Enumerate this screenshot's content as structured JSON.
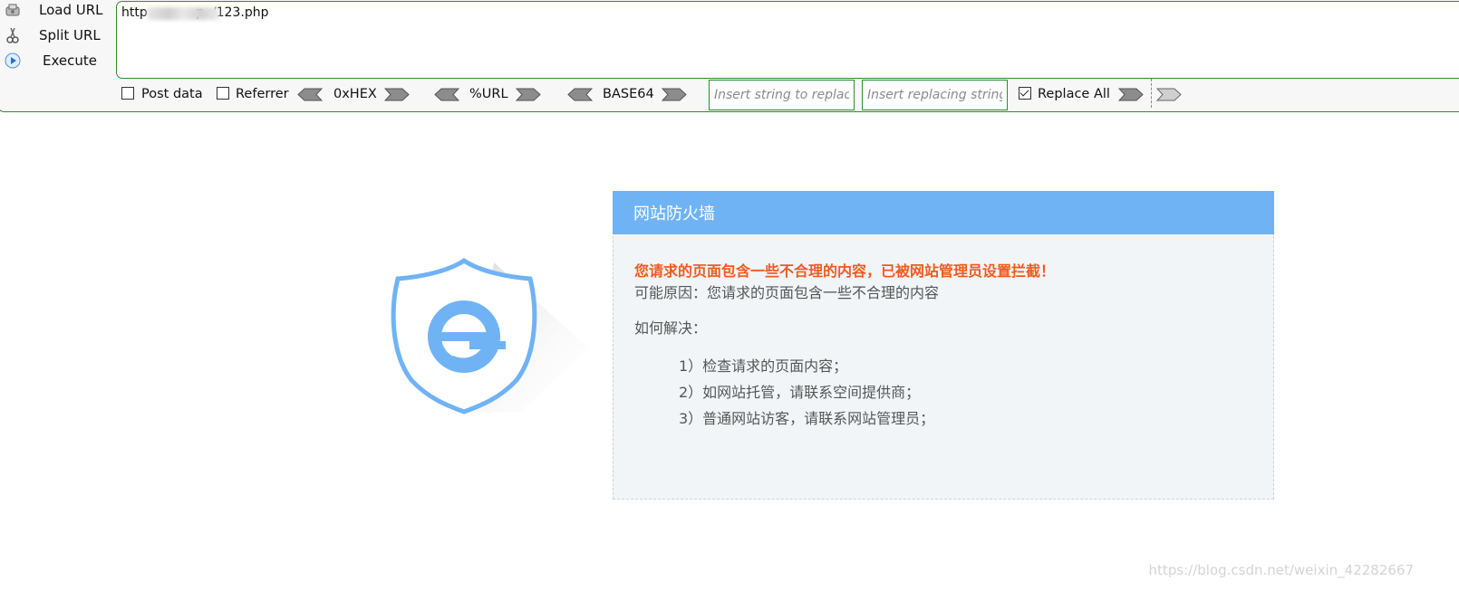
{
  "hackbar": {
    "buttons": [
      {
        "label": "Load URL",
        "icon": "load-url-icon"
      },
      {
        "label": "Split URL",
        "icon": "split-url-icon"
      },
      {
        "label": "Execute",
        "icon": "execute-icon"
      }
    ],
    "url_value": "http            p  /123.php",
    "options": {
      "post_data": {
        "label": "Post data",
        "checked": false
      },
      "referrer": {
        "label": "Referrer",
        "checked": false
      },
      "replace_all": {
        "label": "Replace All",
        "checked": true
      }
    },
    "encoders": [
      "0xHEX",
      "%URL",
      "BASE64"
    ],
    "replace_from_placeholder": "Insert string to replace",
    "replace_to_placeholder": "Insert replacing string",
    "accent_color": "#2e8b2e"
  },
  "firewall": {
    "title": "网站防火墙",
    "warning": "您请求的页面包含一些不合理的内容，已被网站管理员设置拦截！",
    "reason": "可能原因：您请求的页面包含一些不合理的内容",
    "how_to": "如何解决：",
    "solutions": [
      "1）检查请求的页面内容；",
      "2）如网站托管，请联系空间提供商；",
      "3）普通网站访客，请联系网站管理员；"
    ],
    "header_color": "#6fb3f5",
    "warning_color": "#f05a1e",
    "logo_icon": "shield-e-icon"
  },
  "watermark": "https://blog.csdn.net/weixin_42282667"
}
